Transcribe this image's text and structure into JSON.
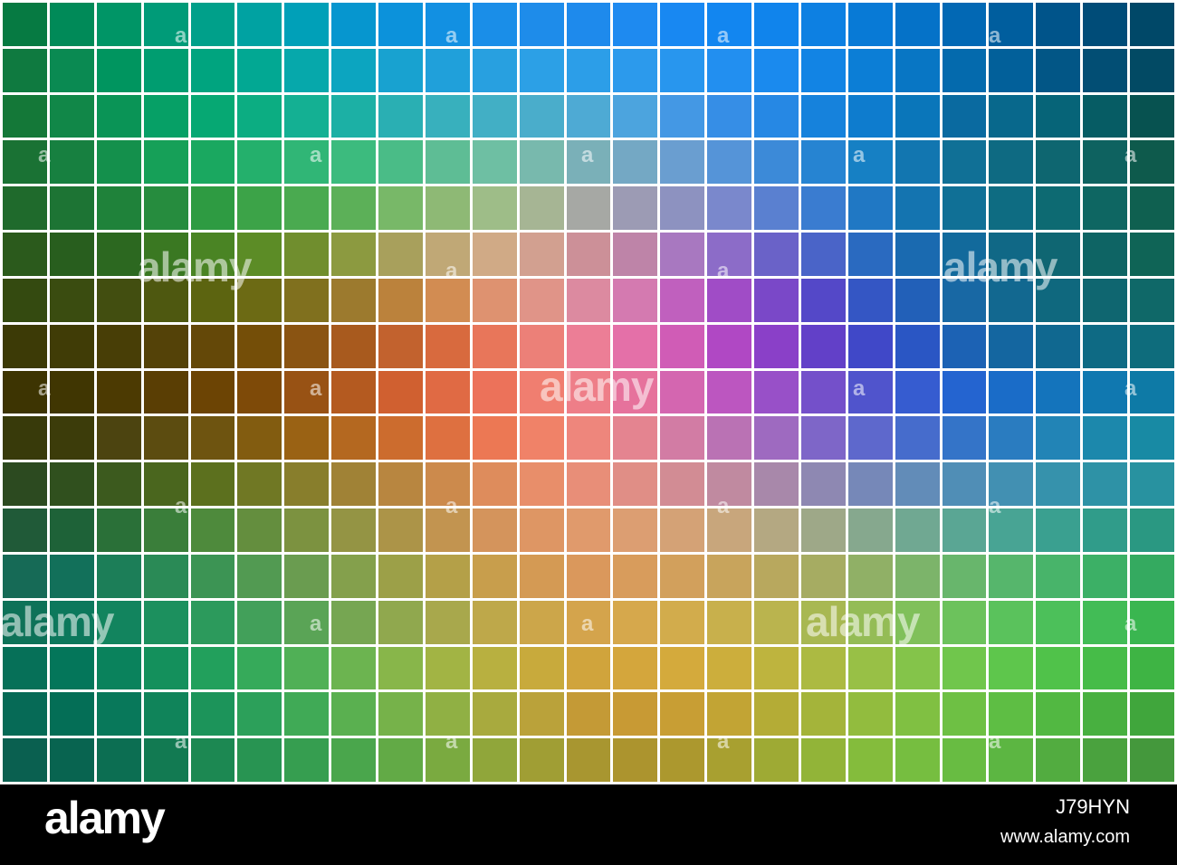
{
  "watermark": {
    "text": "alamy",
    "small_text": "a"
  },
  "footer": {
    "logo": "alamy",
    "image_id": "J79HYN",
    "url": "www.alamy.com"
  },
  "mosaic": {
    "rows": 17,
    "cols": 25,
    "colors": [
      [
        "#067a42",
        "#008a58",
        "#009566",
        "#009b78",
        "#00a08a",
        "#00a2a2",
        "#00a0b8",
        "#0696cf",
        "#0c92db",
        "#1290e2",
        "#1a8ee8",
        "#1e8cea",
        "#1e8aec",
        "#1e8af0",
        "#1888f2",
        "#1286f0",
        "#1084ec",
        "#0d80e2",
        "#087ad6",
        "#0572c8",
        "#0268b4",
        "#005e9e",
        "#00548a",
        "#004c78",
        "#004868"
      ],
      [
        "#0f7a40",
        "#0a8a52",
        "#00955f",
        "#009d70",
        "#00a47f",
        "#02a893",
        "#06a8ab",
        "#0ca5c0",
        "#18a2d0",
        "#20a0da",
        "#28a0e0",
        "#2ca0e6",
        "#2c9ee8",
        "#2c9aec",
        "#2896ee",
        "#228ff0",
        "#1a8aee",
        "#1284e4",
        "#0c7ed6",
        "#0876c4",
        "#046aad",
        "#02609a",
        "#025686",
        "#024e74",
        "#024a64"
      ],
      [
        "#147838",
        "#118748",
        "#0a9456",
        "#06a066",
        "#06a873",
        "#0cad82",
        "#14b093",
        "#1cb0a5",
        "#2aafb3",
        "#38b0bd",
        "#42afc5",
        "#4aadcb",
        "#4eaad4",
        "#4ca4de",
        "#4498e4",
        "#368ee6",
        "#2688e4",
        "#1682dc",
        "#0e7cce",
        "#0a76ba",
        "#0a6aa0",
        "#08688c",
        "#066478",
        "#065c64",
        "#075250"
      ],
      [
        "#1a7234",
        "#178040",
        "#14904c",
        "#16a058",
        "#1aa860",
        "#24b06c",
        "#30b676",
        "#3cbb7e",
        "#4abc87",
        "#5ebd95",
        "#6ebfa3",
        "#78b9ad",
        "#7ab0b8",
        "#74a8c4",
        "#6a9ed0",
        "#5594d8",
        "#3c8ad8",
        "#2684d2",
        "#1680c4",
        "#1276b0",
        "#107096",
        "#0e6a82",
        "#0e6670",
        "#0e6260",
        "#0e5a4c"
      ],
      [
        "#1f6a2c",
        "#1d7434",
        "#1f823a",
        "#268c3e",
        "#2e9b42",
        "#3ca348",
        "#4aaa50",
        "#5cb058",
        "#78b868",
        "#8eb975",
        "#9ebd88",
        "#a6b594",
        "#a6a8a4",
        "#9c9bb4",
        "#8d92c0",
        "#7a88cc",
        "#5a80d0",
        "#3a7cd0",
        "#2078c4",
        "#1474b0",
        "#107096",
        "#0e6c82",
        "#0d6a72",
        "#0e6662",
        "#0f6050"
      ],
      [
        "#2b5a1c",
        "#285e1e",
        "#2c6820",
        "#3a7822",
        "#4a8424",
        "#5c8c26",
        "#708e2e",
        "#8c9a40",
        "#a8a05c",
        "#c0a876",
        "#d0aa86",
        "#d2a090",
        "#cc9098",
        "#be84a8",
        "#a878c0",
        "#8c6cc8",
        "#6a62c8",
        "#4a64c8",
        "#2a6ac0",
        "#1a6ab0",
        "#126a9c",
        "#106886",
        "#0f6672",
        "#0e6464",
        "#0f6456"
      ],
      [
        "#344a10",
        "#3a4c10",
        "#424e10",
        "#4e5810",
        "#5c6410",
        "#6c6a14",
        "#80701e",
        "#9c7a2e",
        "#bb823c",
        "#d28c52",
        "#de9270",
        "#e09488",
        "#dc8aa0",
        "#d47ab0",
        "#c060be",
        "#a04cc6",
        "#7a48c8",
        "#5448c8",
        "#3456c4",
        "#2260b8",
        "#1868a4",
        "#126890",
        "#0f687e",
        "#0f6670",
        "#0f6868"
      ],
      [
        "#3c3a06",
        "#403c06",
        "#483e06",
        "#544208",
        "#644808",
        "#744e08",
        "#8a5412",
        "#a85a1e",
        "#c2622e",
        "#d86a3e",
        "#e8765a",
        "#ec8078",
        "#ec7e96",
        "#e470a8",
        "#d05cb6",
        "#b048c4",
        "#8a40c8",
        "#6240c8",
        "#4048c8",
        "#2a56c4",
        "#1c62b4",
        "#1466a0",
        "#106890",
        "#0e6a84",
        "#0e6c7c"
      ],
      [
        "#3d3402",
        "#403602",
        "#4c3a02",
        "#5a3e04",
        "#6c4404",
        "#7e4a08",
        "#985214",
        "#b45a20",
        "#d06030",
        "#e06a44",
        "#ec725a",
        "#f07e70",
        "#ee7e88",
        "#e6729c",
        "#d466b0",
        "#bc56c0",
        "#9850c8",
        "#7450ca",
        "#5054cc",
        "#365cd0",
        "#2464d0",
        "#1a6cc8",
        "#1474bc",
        "#1078b0",
        "#0e7aa6"
      ],
      [
        "#383a0a",
        "#3c3c0a",
        "#4c4410",
        "#5c4c10",
        "#6e5410",
        "#825c10",
        "#9a6214",
        "#b46820",
        "#cc6c2e",
        "#de7040",
        "#ec7854",
        "#f08268",
        "#ee867c",
        "#e48490",
        "#d27ca4",
        "#ba72b4",
        "#9e6ac0",
        "#7e66c8",
        "#5e68cc",
        "#466ccc",
        "#3474c8",
        "#2a7cc0",
        "#2284b6",
        "#1c88ac",
        "#188aa4"
      ],
      [
        "#2c4a20",
        "#30501e",
        "#3c5a1e",
        "#4a661e",
        "#5c701e",
        "#707824",
        "#887e2c",
        "#a08236",
        "#b88640",
        "#cc8a4c",
        "#de8c5c",
        "#e88e6a",
        "#e88e78",
        "#e08e86",
        "#d28c94",
        "#c08aa0",
        "#a888aa",
        "#8e88b2",
        "#7688b8",
        "#628cb8",
        "#508eb6",
        "#4290b2",
        "#3692ac",
        "#2e92a6",
        "#2892a0"
      ],
      [
        "#205a38",
        "#1e6238",
        "#2a7038",
        "#3a7e3a",
        "#4e8a3c",
        "#648e3e",
        "#7c9240",
        "#949444",
        "#ac9448",
        "#c29450",
        "#d4945c",
        "#de9664",
        "#e09a6c",
        "#dc9e72",
        "#d4a276",
        "#c8a67c",
        "#b4a882",
        "#9ea888",
        "#86a88e",
        "#70a892",
        "#5aa694",
        "#48a494",
        "#3aa090",
        "#309c8a",
        "#2a9882"
      ],
      [
        "#166a56",
        "#12705a",
        "#1c7e58",
        "#2a8a56",
        "#3c9454",
        "#529a52",
        "#6a9c50",
        "#84a04c",
        "#9ca048",
        "#b4a048",
        "#c89e4c",
        "#d49a54",
        "#da985c",
        "#d89c5c",
        "#d2a05c",
        "#c8a45c",
        "#b8a85e",
        "#a6ac62",
        "#90b066",
        "#7cb46a",
        "#68b66c",
        "#56b66c",
        "#48b46a",
        "#3cb066",
        "#34aa60"
      ],
      [
        "#0e7258",
        "#0c785c",
        "#12845e",
        "#1c905e",
        "#2c9a5c",
        "#42a05a",
        "#5aa456",
        "#76a652",
        "#90a84e",
        "#a8a84c",
        "#bea84a",
        "#cca64a",
        "#d4a44c",
        "#d6a84c",
        "#d2ac4c",
        "#c8b04c",
        "#bab44e",
        "#a8b852",
        "#94bc56",
        "#80c05a",
        "#6cc25c",
        "#5ac25c",
        "#4cc05a",
        "#42bc56",
        "#3ab650"
      ],
      [
        "#067058",
        "#04765a",
        "#0a825c",
        "#14905c",
        "#22a05c",
        "#36aa5a",
        "#50b056",
        "#6cb450",
        "#88b64a",
        "#a2b444",
        "#b8b040",
        "#c8aa3c",
        "#d0a43c",
        "#d4a63c",
        "#d4aa3c",
        "#ccae3c",
        "#beb43e",
        "#acba42",
        "#98c046",
        "#84c44a",
        "#70c64c",
        "#5ec64c",
        "#50c24a",
        "#46bc48",
        "#3eb444"
      ],
      [
        "#066a56",
        "#046e56",
        "#08785a",
        "#10845a",
        "#1c945a",
        "#2ca05a",
        "#40aa56",
        "#5ab050",
        "#76b24a",
        "#90b044",
        "#a8aa3e",
        "#baa23a",
        "#c49a36",
        "#c89a34",
        "#c89e34",
        "#c2a434",
        "#b4ac36",
        "#a4b43a",
        "#92bc3e",
        "#80c042",
        "#6ec044",
        "#5ebe44",
        "#52b842",
        "#48b040",
        "#40a63c"
      ],
      [
        "#0a6050",
        "#086450",
        "#0c6e52",
        "#127a52",
        "#1c8852",
        "#289452",
        "#369e50",
        "#4aa64c",
        "#62aa46",
        "#7aaa40",
        "#90a63a",
        "#a09e34",
        "#a89630",
        "#ac942e",
        "#ac982e",
        "#a8a030",
        "#9eaa34",
        "#92b438",
        "#84bc3c",
        "#76be40",
        "#68bc42",
        "#5cb642",
        "#52ac40",
        "#4aa23e",
        "#44983c"
      ]
    ]
  }
}
